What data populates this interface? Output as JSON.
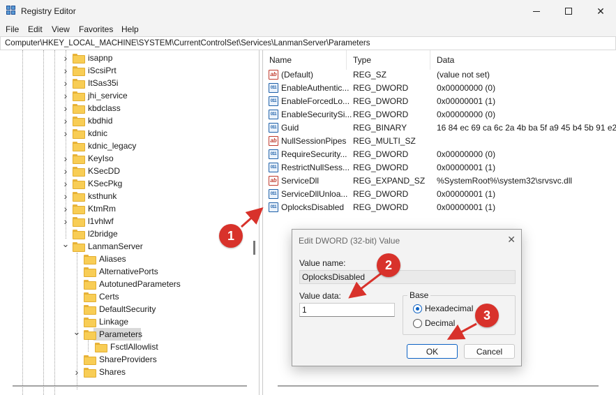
{
  "window": {
    "title": "Registry Editor"
  },
  "menu": [
    "File",
    "Edit",
    "View",
    "Favorites",
    "Help"
  ],
  "address": "Computer\\HKEY_LOCAL_MACHINE\\SYSTEM\\CurrentControlSet\\Services\\LanmanServer\\Parameters",
  "tree": {
    "items": [
      {
        "label": "isapnp",
        "expanded": false
      },
      {
        "label": "iScsiPrt",
        "expanded": false
      },
      {
        "label": "ItSas35i",
        "expanded": false
      },
      {
        "label": "jhi_service",
        "expanded": false
      },
      {
        "label": "kbdclass",
        "expanded": false
      },
      {
        "label": "kbdhid",
        "expanded": false
      },
      {
        "label": "kdnic",
        "expanded": false
      },
      {
        "label": "kdnic_legacy",
        "expanded": null
      },
      {
        "label": "KeyIso",
        "expanded": false
      },
      {
        "label": "KSecDD",
        "expanded": false
      },
      {
        "label": "KSecPkg",
        "expanded": false
      },
      {
        "label": "ksthunk",
        "expanded": false
      },
      {
        "label": "KtmRm",
        "expanded": false
      },
      {
        "label": "l1vhlwf",
        "expanded": false
      },
      {
        "label": "l2bridge",
        "expanded": null
      },
      {
        "label": "LanmanServer",
        "expanded": true
      },
      {
        "label": "Aliases",
        "expanded": null
      },
      {
        "label": "AlternativePorts",
        "expanded": null
      },
      {
        "label": "AutotunedParameters",
        "expanded": null
      },
      {
        "label": "Certs",
        "expanded": null
      },
      {
        "label": "DefaultSecurity",
        "expanded": null
      },
      {
        "label": "Linkage",
        "expanded": null
      },
      {
        "label": "Parameters",
        "expanded": true
      },
      {
        "label": "FsctlAllowlist",
        "expanded": null
      },
      {
        "label": "ShareProviders",
        "expanded": null
      },
      {
        "label": "Shares",
        "expanded": false
      }
    ]
  },
  "columns": {
    "name": "Name",
    "type": "Type",
    "data": "Data"
  },
  "values": [
    {
      "name": "(Default)",
      "type": "REG_SZ",
      "data": "(value not set)",
      "icon": "string-icon"
    },
    {
      "name": "EnableAuthentic...",
      "type": "REG_DWORD",
      "data": "0x00000000 (0)",
      "icon": "binary-icon"
    },
    {
      "name": "EnableForcedLo...",
      "type": "REG_DWORD",
      "data": "0x00000001 (1)",
      "icon": "binary-icon"
    },
    {
      "name": "EnableSecuritySi...",
      "type": "REG_DWORD",
      "data": "0x00000000 (0)",
      "icon": "binary-icon"
    },
    {
      "name": "Guid",
      "type": "REG_BINARY",
      "data": "16 84 ec 69 ca 6c 2a 4b ba 5f a9 45 b4 5b 91 e2",
      "icon": "binary-icon"
    },
    {
      "name": "NullSessionPipes",
      "type": "REG_MULTI_SZ",
      "data": "",
      "icon": "string-icon"
    },
    {
      "name": "RequireSecurity...",
      "type": "REG_DWORD",
      "data": "0x00000000 (0)",
      "icon": "binary-icon"
    },
    {
      "name": "RestrictNullSess...",
      "type": "REG_DWORD",
      "data": "0x00000001 (1)",
      "icon": "binary-icon"
    },
    {
      "name": "ServiceDll",
      "type": "REG_EXPAND_SZ",
      "data": "%SystemRoot%\\system32\\srvsvc.dll",
      "icon": "string-icon"
    },
    {
      "name": "ServiceDllUnloa...",
      "type": "REG_DWORD",
      "data": "0x00000001 (1)",
      "icon": "binary-icon"
    },
    {
      "name": "OplocksDisabled",
      "type": "REG_DWORD",
      "data": "0x00000001 (1)",
      "icon": "binary-icon"
    }
  ],
  "dialog": {
    "title": "Edit DWORD (32-bit) Value",
    "value_name_label": "Value name:",
    "value_name": "OplocksDisabled",
    "value_data_label": "Value data:",
    "value_data": "1",
    "base_label": "Base",
    "hex_label": "Hexadecimal",
    "decimal_label": "Decimal",
    "base_selected": "Hexadecimal",
    "ok_label": "OK",
    "cancel_label": "Cancel"
  },
  "annotations": {
    "step1": "1",
    "step2": "2",
    "step3": "3",
    "color": "#d8322b"
  }
}
